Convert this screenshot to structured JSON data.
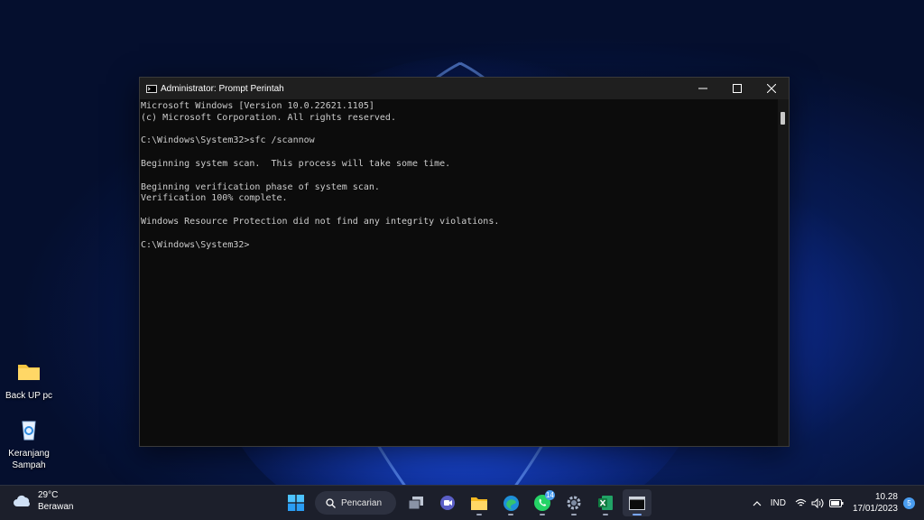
{
  "desktop": {
    "icons": [
      {
        "label": "Back UP pc"
      },
      {
        "label": "Keranjang Sampah"
      }
    ]
  },
  "window": {
    "title": "Administrator: Prompt Perintah",
    "console_lines": [
      "Microsoft Windows [Version 10.0.22621.1105]",
      "(c) Microsoft Corporation. All rights reserved.",
      "",
      "C:\\Windows\\System32>sfc /scannow",
      "",
      "Beginning system scan.  This process will take some time.",
      "",
      "Beginning verification phase of system scan.",
      "Verification 100% complete.",
      "",
      "Windows Resource Protection did not find any integrity violations.",
      "",
      "C:\\Windows\\System32>"
    ]
  },
  "taskbar": {
    "weather": {
      "temp": "29°C",
      "condition": "Berawan"
    },
    "search_label": "Pencarian",
    "whatsapp_badge": "14",
    "tray": {
      "language": "IND",
      "time": "10.28",
      "date": "17/01/2023",
      "notifications": "5"
    }
  }
}
